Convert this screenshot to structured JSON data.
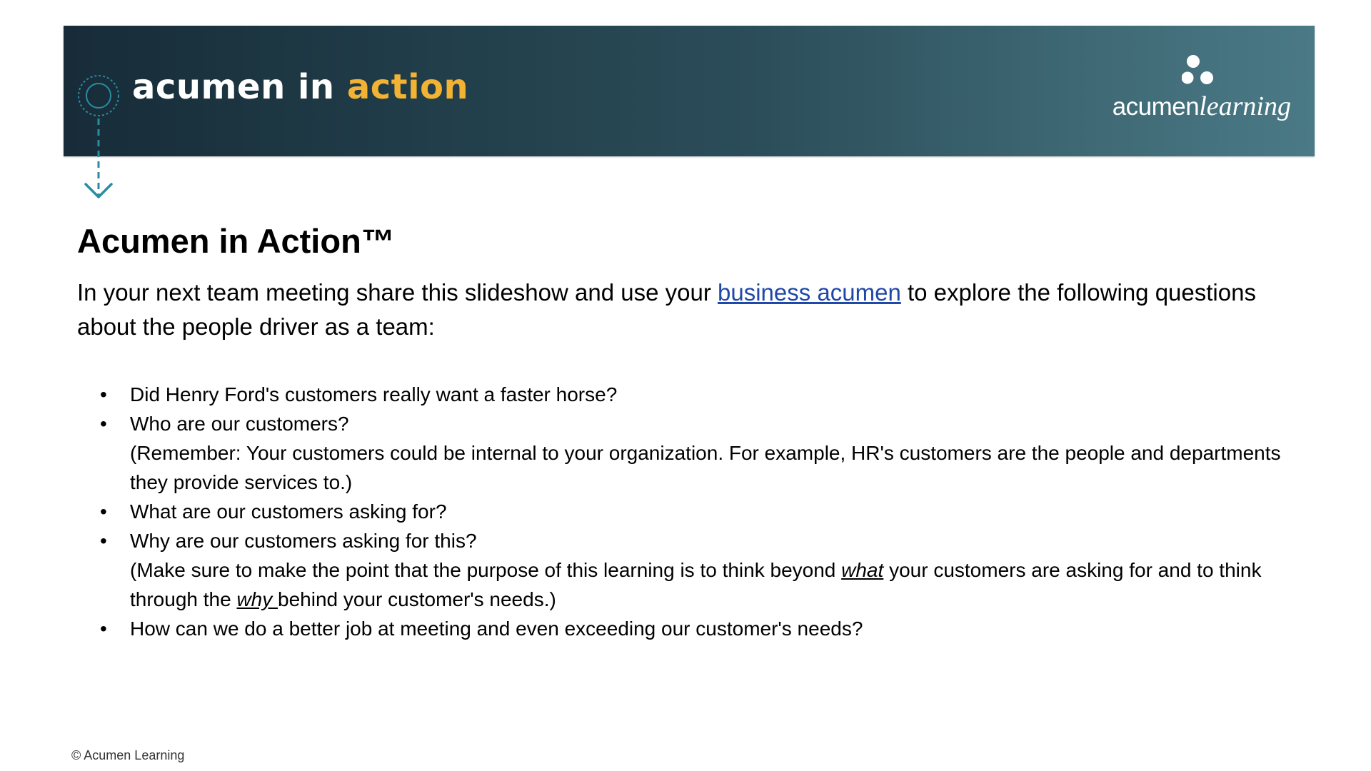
{
  "banner": {
    "title_prefix": "acumen in ",
    "title_highlight": "action",
    "logo": {
      "text_plain": "acumen",
      "text_script": "learning"
    }
  },
  "heading": "Acumen in Action™",
  "intro": {
    "before_link": "In your next team meeting share this slideshow and use your ",
    "link_text": "business acumen",
    "after_link": " to explore the following questions about the people driver as a team:"
  },
  "questions": [
    {
      "text": "Did Henry Ford's customers really want a faster horse?"
    },
    {
      "text": "Who are our customers?",
      "note": "(Remember: Your customers could be internal to your organization. For example, HR's customers are the people and departments they provide services to.)"
    },
    {
      "text": "What are our customers asking for?"
    },
    {
      "text": "Why are our customers asking for this?",
      "note_part1": "(Make sure to make the point that the purpose of this learning is to think beyond ",
      "note_em1": "what",
      "note_part2": " your customers are asking for and to think through the ",
      "note_em2": "why ",
      "note_part3": "behind your customer's needs.)"
    },
    {
      "text": "How can we do a better job at meeting and even exceeding our customer's needs?"
    }
  ],
  "footer": "© Acumen Learning",
  "colors": {
    "banner_dark": "#172c38",
    "banner_light": "#4a7a86",
    "accent_gold": "#f2b233",
    "icon_teal": "#2a8ca3",
    "link_blue": "#1f48a8"
  },
  "icons": [
    "target-icon",
    "arrow-down-icon",
    "acumen-logo-mark"
  ]
}
